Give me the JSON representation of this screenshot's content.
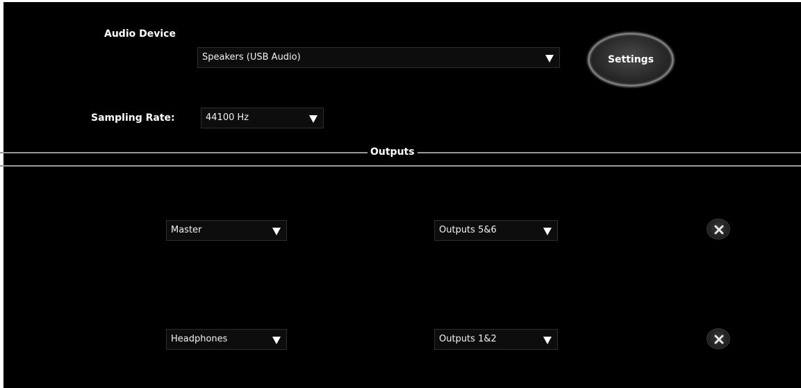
{
  "audio_device": {
    "label": "Audio Device",
    "selected": "Speakers (USB Audio)",
    "settings_label": "Settings"
  },
  "sampling_rate": {
    "label": "Sampling Rate:",
    "selected": "44100 Hz"
  },
  "outputs": {
    "title": "Outputs",
    "rows": [
      {
        "channel": "Master",
        "output": "Outputs 5&6"
      },
      {
        "channel": "Headphones",
        "output": "Outputs 1&2"
      }
    ]
  },
  "icons": {
    "dropdown_arrow": "triangle-down-icon",
    "remove": "close-icon"
  },
  "colors": {
    "background": "#000000",
    "text": "#ffffff",
    "divider": "#9a9a9a"
  }
}
